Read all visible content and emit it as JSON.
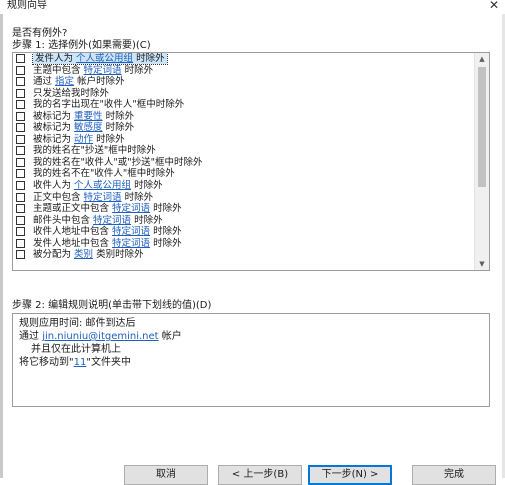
{
  "window": {
    "title": "规则向导",
    "close_glyph": "✕"
  },
  "question": "是否有例外?",
  "step1": {
    "label": "步骤 1: 选择例外(如果需要)(C)"
  },
  "exceptions": [
    {
      "before": "发件人为 ",
      "link": "个人或公用组",
      "after": " 时除外",
      "checked": false,
      "selected": true
    },
    {
      "before": "主题中包含 ",
      "link": "特定词语",
      "after": " 时除外",
      "checked": false
    },
    {
      "before": "通过 ",
      "link": "指定",
      "after": " 帐户时除外",
      "checked": false
    },
    {
      "before": "只发送给我时除外",
      "link": "",
      "after": "",
      "checked": false
    },
    {
      "before": "我的名字出现在\"收件人\"框中时除外",
      "link": "",
      "after": "",
      "checked": false
    },
    {
      "before": "被标记为 ",
      "link": "重要性",
      "after": " 时除外",
      "checked": false
    },
    {
      "before": "被标记为 ",
      "link": "敏感度",
      "after": " 时除外",
      "checked": false
    },
    {
      "before": "被标记为 ",
      "link": "动作",
      "after": " 时除外",
      "checked": false
    },
    {
      "before": "我的姓名在\"抄送\"框中时除外",
      "link": "",
      "after": "",
      "checked": false
    },
    {
      "before": "我的姓名在\"收件人\"或\"抄送\"框中时除外",
      "link": "",
      "after": "",
      "checked": false
    },
    {
      "before": "我的姓名不在\"收件人\"框中时除外",
      "link": "",
      "after": "",
      "checked": false
    },
    {
      "before": "收件人为 ",
      "link": "个人或公用组",
      "after": " 时除外",
      "checked": false
    },
    {
      "before": "正文中包含 ",
      "link": "特定词语",
      "after": " 时除外",
      "checked": false
    },
    {
      "before": "主题或正文中包含 ",
      "link": "特定词语",
      "after": " 时除外",
      "checked": false
    },
    {
      "before": "邮件头中包含 ",
      "link": "特定词语",
      "after": " 时除外",
      "checked": false
    },
    {
      "before": "收件人地址中包含 ",
      "link": "特定词语",
      "after": " 时除外",
      "checked": false
    },
    {
      "before": "发件人地址中包含 ",
      "link": "特定词语",
      "after": " 时除外",
      "checked": false
    },
    {
      "before": "被分配为 ",
      "link": "类别",
      "after": " 类别时除外",
      "checked": false
    }
  ],
  "step2": {
    "label": "步骤 2: 编辑规则说明(单击带下划线的值)(D)"
  },
  "description": {
    "line1": "规则应用时间: 邮件到达后",
    "line2_before": "通过 ",
    "line2_link": "jin.niuniu@itgemini.net",
    "line2_after": " 帐户",
    "line3": "并且仅在此计算机上",
    "line4_before": "将它移动到\"",
    "line4_link": "11",
    "line4_after": "\"文件夹中"
  },
  "buttons": {
    "cancel": "取消",
    "back": "< 上一步(B)",
    "next": "下一步(N) >",
    "finish": "完成"
  },
  "icons": {
    "scroll_up": "▲",
    "scroll_down": "▼"
  }
}
